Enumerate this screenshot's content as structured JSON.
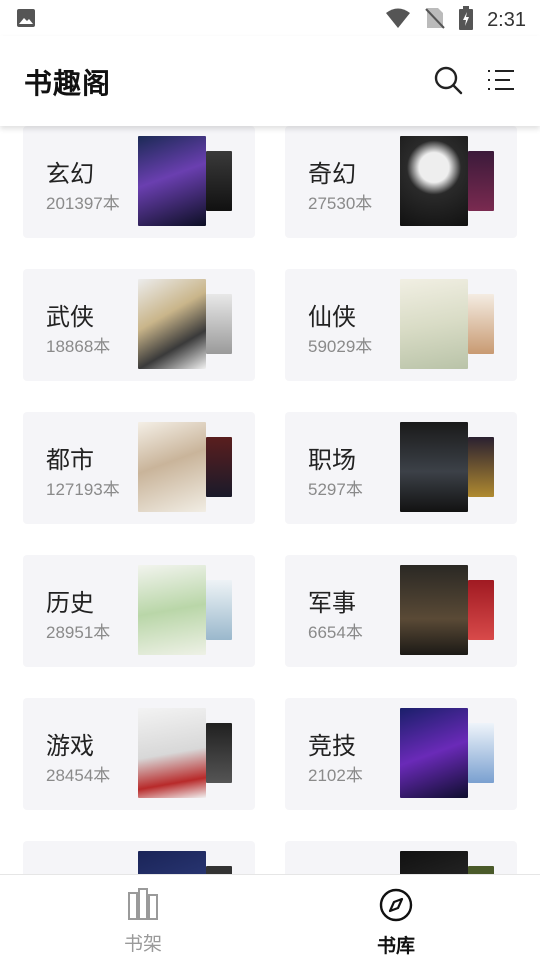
{
  "status": {
    "time": "2:31"
  },
  "header": {
    "title": "书趣阁"
  },
  "categories": [
    {
      "name": "玄幻",
      "count": "201397本"
    },
    {
      "name": "奇幻",
      "count": "27530本"
    },
    {
      "name": "武侠",
      "count": "18868本"
    },
    {
      "name": "仙侠",
      "count": "59029本"
    },
    {
      "name": "都市",
      "count": "127193本"
    },
    {
      "name": "职场",
      "count": "5297本"
    },
    {
      "name": "历史",
      "count": "28951本"
    },
    {
      "name": "军事",
      "count": "6654本"
    },
    {
      "name": "游戏",
      "count": "28454本"
    },
    {
      "name": "竞技",
      "count": "2102本"
    }
  ],
  "bottom_nav": {
    "shelf_label": "书架",
    "library_label": "书库"
  }
}
